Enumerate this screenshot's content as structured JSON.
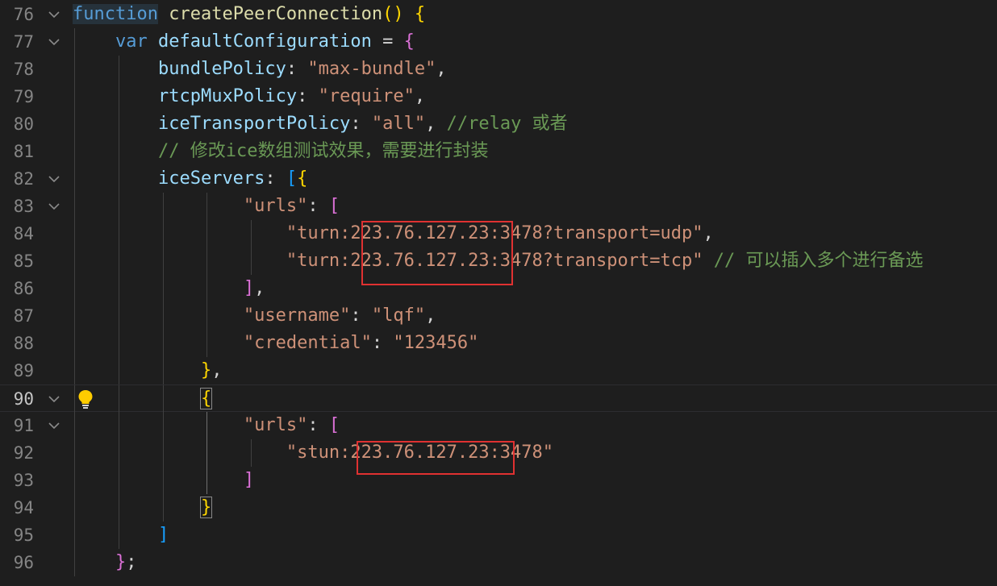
{
  "editor": {
    "lines": [
      {
        "num": "76",
        "fold": true,
        "tokens": [
          {
            "t": "function",
            "c": "kw-hl"
          },
          {
            "t": " ",
            "c": "pun"
          },
          {
            "t": "createPeerConnection",
            "c": "fn"
          },
          {
            "t": "(",
            "c": "b1"
          },
          {
            "t": ")",
            "c": "b1"
          },
          {
            "t": " ",
            "c": "pun"
          },
          {
            "t": "{",
            "c": "b1"
          }
        ]
      },
      {
        "num": "77",
        "fold": true,
        "tokens": [
          {
            "t": "    ",
            "c": "pun"
          },
          {
            "t": "var",
            "c": "kw"
          },
          {
            "t": " ",
            "c": "pun"
          },
          {
            "t": "defaultConfiguration",
            "c": "var"
          },
          {
            "t": " = ",
            "c": "pun"
          },
          {
            "t": "{",
            "c": "b2"
          }
        ]
      },
      {
        "num": "78",
        "fold": false,
        "tokens": [
          {
            "t": "        ",
            "c": "pun"
          },
          {
            "t": "bundlePolicy",
            "c": "prop"
          },
          {
            "t": ": ",
            "c": "pun"
          },
          {
            "t": "\"max-bundle\"",
            "c": "str"
          },
          {
            "t": ",",
            "c": "pun"
          }
        ]
      },
      {
        "num": "79",
        "fold": false,
        "tokens": [
          {
            "t": "        ",
            "c": "pun"
          },
          {
            "t": "rtcpMuxPolicy",
            "c": "prop"
          },
          {
            "t": ": ",
            "c": "pun"
          },
          {
            "t": "\"require\"",
            "c": "str"
          },
          {
            "t": ",",
            "c": "pun"
          }
        ]
      },
      {
        "num": "80",
        "fold": false,
        "tokens": [
          {
            "t": "        ",
            "c": "pun"
          },
          {
            "t": "iceTransportPolicy",
            "c": "prop"
          },
          {
            "t": ": ",
            "c": "pun"
          },
          {
            "t": "\"all\"",
            "c": "str"
          },
          {
            "t": ", ",
            "c": "pun"
          },
          {
            "t": "//relay 或者",
            "c": "cmt"
          }
        ]
      },
      {
        "num": "81",
        "fold": false,
        "tokens": [
          {
            "t": "        ",
            "c": "pun"
          },
          {
            "t": "// 修改ice数组测试效果，需要进行封装",
            "c": "cmt"
          }
        ]
      },
      {
        "num": "82",
        "fold": true,
        "tokens": [
          {
            "t": "        ",
            "c": "pun"
          },
          {
            "t": "iceServers",
            "c": "prop"
          },
          {
            "t": ": ",
            "c": "pun"
          },
          {
            "t": "[",
            "c": "b3"
          },
          {
            "t": "{",
            "c": "b1"
          }
        ]
      },
      {
        "num": "83",
        "fold": true,
        "tokens": [
          {
            "t": "                ",
            "c": "pun"
          },
          {
            "t": "\"urls\"",
            "c": "str"
          },
          {
            "t": ": ",
            "c": "pun"
          },
          {
            "t": "[",
            "c": "b2"
          }
        ]
      },
      {
        "num": "84",
        "fold": false,
        "tokens": [
          {
            "t": "                    ",
            "c": "pun"
          },
          {
            "t": "\"turn:223.76.127.23:3478?transport=udp\"",
            "c": "str"
          },
          {
            "t": ",",
            "c": "pun"
          }
        ]
      },
      {
        "num": "85",
        "fold": false,
        "tokens": [
          {
            "t": "                    ",
            "c": "pun"
          },
          {
            "t": "\"turn:223.76.127.23:3478?transport=tcp\"",
            "c": "str"
          },
          {
            "t": " ",
            "c": "pun"
          },
          {
            "t": "// 可以插入多个进行备选",
            "c": "cmt"
          }
        ]
      },
      {
        "num": "86",
        "fold": false,
        "tokens": [
          {
            "t": "                ",
            "c": "pun"
          },
          {
            "t": "]",
            "c": "b2"
          },
          {
            "t": ",",
            "c": "pun"
          }
        ]
      },
      {
        "num": "87",
        "fold": false,
        "tokens": [
          {
            "t": "                ",
            "c": "pun"
          },
          {
            "t": "\"username\"",
            "c": "str"
          },
          {
            "t": ": ",
            "c": "pun"
          },
          {
            "t": "\"lqf\"",
            "c": "str"
          },
          {
            "t": ",",
            "c": "pun"
          }
        ]
      },
      {
        "num": "88",
        "fold": false,
        "tokens": [
          {
            "t": "                ",
            "c": "pun"
          },
          {
            "t": "\"credential\"",
            "c": "str"
          },
          {
            "t": ": ",
            "c": "pun"
          },
          {
            "t": "\"123456\"",
            "c": "str"
          }
        ]
      },
      {
        "num": "89",
        "fold": false,
        "tokens": [
          {
            "t": "            ",
            "c": "pun"
          },
          {
            "t": "}",
            "c": "b1"
          },
          {
            "t": ",",
            "c": "pun"
          }
        ]
      },
      {
        "num": "90",
        "fold": true,
        "active": true,
        "bulb": true,
        "tokens": [
          {
            "t": "            ",
            "c": "pun"
          },
          {
            "t": "{",
            "c": "b1 bm"
          }
        ]
      },
      {
        "num": "91",
        "fold": true,
        "tokens": [
          {
            "t": "                ",
            "c": "pun"
          },
          {
            "t": "\"urls\"",
            "c": "str"
          },
          {
            "t": ": ",
            "c": "pun"
          },
          {
            "t": "[",
            "c": "b2"
          }
        ]
      },
      {
        "num": "92",
        "fold": false,
        "tokens": [
          {
            "t": "                    ",
            "c": "pun"
          },
          {
            "t": "\"stun:223.76.127.23:3478\"",
            "c": "str"
          }
        ]
      },
      {
        "num": "93",
        "fold": false,
        "tokens": [
          {
            "t": "                ",
            "c": "pun"
          },
          {
            "t": "]",
            "c": "b2"
          }
        ]
      },
      {
        "num": "94",
        "fold": false,
        "tokens": [
          {
            "t": "            ",
            "c": "pun"
          },
          {
            "t": "}",
            "c": "b1 bm"
          }
        ]
      },
      {
        "num": "95",
        "fold": false,
        "tokens": [
          {
            "t": "        ",
            "c": "pun"
          },
          {
            "t": "]",
            "c": "b3"
          }
        ]
      },
      {
        "num": "96",
        "fold": false,
        "tokens": [
          {
            "t": "    ",
            "c": "pun"
          },
          {
            "t": "}",
            "c": "b2"
          },
          {
            "t": ";",
            "c": "pun"
          }
        ]
      }
    ]
  },
  "colors": {
    "background": "#1e1e1e",
    "keyword": "#569cd6",
    "function": "#dcdcaa",
    "variable": "#9cdcfe",
    "string": "#ce9178",
    "comment": "#6a9955",
    "bracket_gold": "#ffd700",
    "bracket_orchid": "#da70d6",
    "bracket_blue": "#179fff",
    "annotation_box": "#e03131",
    "lightbulb": "#ffcc00"
  },
  "icons": {
    "fold": "chevron-down-icon",
    "bulb": "lightbulb-icon"
  }
}
